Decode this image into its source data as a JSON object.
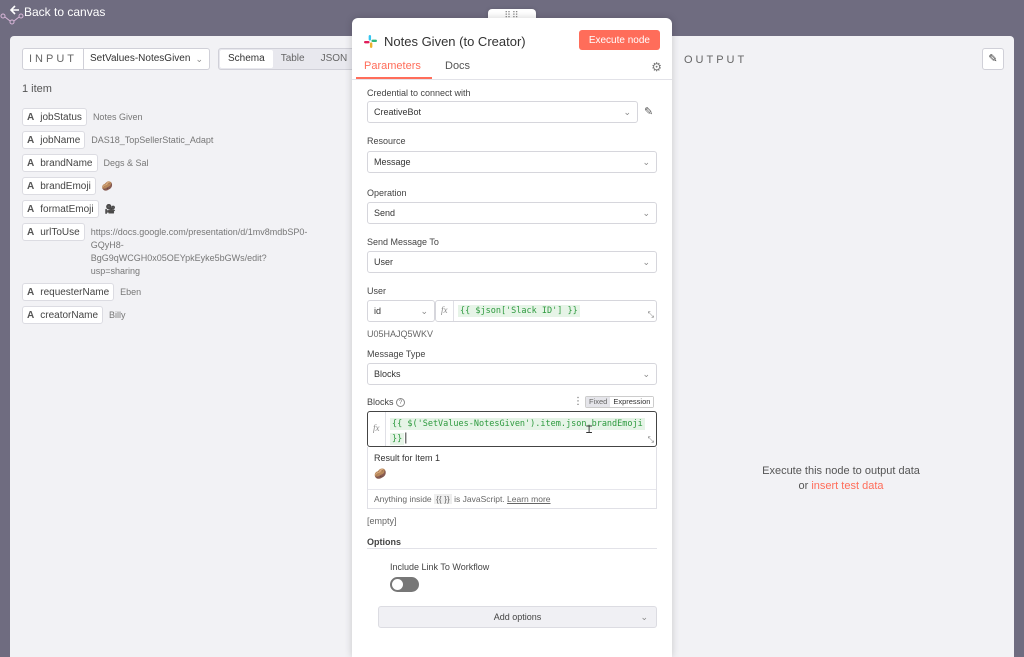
{
  "topbar": {
    "back_label": "Back to canvas"
  },
  "input_panel": {
    "title": "INPUT",
    "node_name": "SetValues-NotesGiven",
    "tabs": [
      "Schema",
      "Table",
      "JSON"
    ],
    "active_tab": "Schema",
    "item_count": "1 item",
    "fields": [
      {
        "type": "A",
        "name": "jobStatus",
        "value": "Notes Given"
      },
      {
        "type": "A",
        "name": "jobName",
        "value": "DAS18_TopSellerStatic_Adapt"
      },
      {
        "type": "A",
        "name": "brandName",
        "value": "Degs & Sal"
      },
      {
        "type": "A",
        "name": "brandEmoji",
        "value": "🥔"
      },
      {
        "type": "A",
        "name": "formatEmoji",
        "value": "🎥"
      },
      {
        "type": "A",
        "name": "urlToUse",
        "value": "https://docs.google.com/presentation/d/1mv8mdbSP0-GQyH8-BgG9qWCGH0x05OEYpkEyke5bGWs/edit?usp=sharing"
      },
      {
        "type": "A",
        "name": "requesterName",
        "value": "Eben"
      },
      {
        "type": "A",
        "name": "creatorName",
        "value": "Billy"
      }
    ]
  },
  "node": {
    "title": "Notes Given (to Creator)",
    "execute_label": "Execute node",
    "tabs": {
      "parameters": "Parameters",
      "docs": "Docs"
    },
    "credential": {
      "label": "Credential to connect with",
      "value": "CreativeBot"
    },
    "resource": {
      "label": "Resource",
      "value": "Message"
    },
    "operation": {
      "label": "Operation",
      "value": "Send"
    },
    "send_to": {
      "label": "Send Message To",
      "value": "User"
    },
    "user": {
      "label": "User",
      "mode": "id",
      "expression": "{{ $json['Slack ID'] }}",
      "resolved": "U05HAJQ5WKV"
    },
    "message_type": {
      "label": "Message Type",
      "value": "Blocks"
    },
    "blocks": {
      "label": "Blocks",
      "toggle_fixed": "Fixed",
      "toggle_expression": "Expression",
      "expression_line1": "{{ $('SetValues-NotesGiven').item.json.brandEmoji",
      "expression_line2": "}}",
      "result_label": "Result for Item 1",
      "result_value": "🥔",
      "hint_prefix": "Anything inside",
      "hint_braces": "{{ }}",
      "hint_suffix": "is JavaScript.",
      "hint_link": "Learn more",
      "empty_note": "[empty]"
    },
    "options": {
      "label": "Options",
      "include_link_label": "Include Link To Workflow",
      "include_link_enabled": false,
      "add_options_label": "Add options"
    }
  },
  "output_panel": {
    "title": "OUTPUT",
    "message_line1": "Execute this node to output data",
    "message_or": "or",
    "message_link": "insert test data"
  },
  "colors": {
    "accent": "#ff6d5a",
    "expression_green": "#2d9a3e",
    "canvas_bg": "#6f6c80"
  }
}
